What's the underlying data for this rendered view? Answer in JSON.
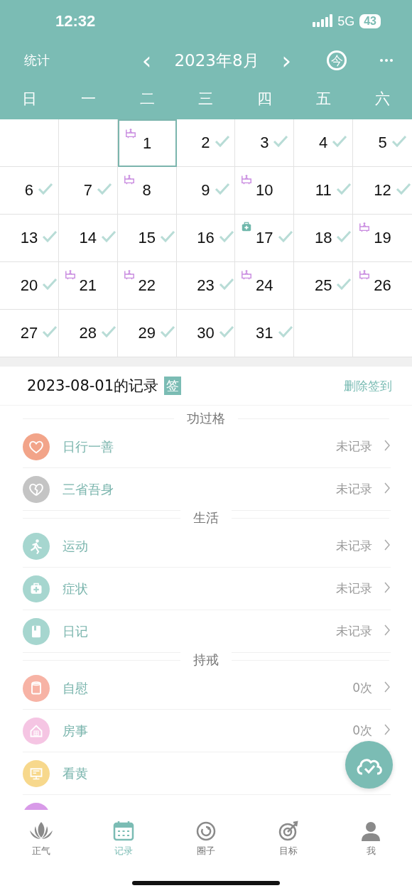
{
  "status_bar": {
    "time": "12:32",
    "network": "5G",
    "battery": "43"
  },
  "month_nav": {
    "stats": "统计",
    "prev": "‹",
    "title": "2023年8月",
    "next": "›",
    "today": "今"
  },
  "weekdays": [
    "日",
    "一",
    "二",
    "三",
    "四",
    "五",
    "六"
  ],
  "calendar": {
    "cells": [
      {
        "kind": "blank"
      },
      {
        "kind": "blank"
      },
      {
        "kind": "bath-day",
        "day": "1",
        "checked": false,
        "selected": true
      },
      {
        "kind": "day",
        "day": "2",
        "checked": true,
        "selected": false
      },
      {
        "kind": "day",
        "day": "3",
        "checked": true,
        "selected": false
      },
      {
        "kind": "day",
        "day": "4",
        "checked": true,
        "selected": false
      },
      {
        "kind": "day",
        "day": "5",
        "checked": true,
        "selected": false
      },
      {
        "kind": "day",
        "day": "6",
        "checked": true,
        "selected": false
      },
      {
        "kind": "day",
        "day": "7",
        "checked": true,
        "selected": false
      },
      {
        "kind": "bath-day",
        "day": "8",
        "checked": false,
        "selected": false
      },
      {
        "kind": "day",
        "day": "9",
        "checked": true,
        "selected": false
      },
      {
        "kind": "bath-day",
        "day": "10",
        "checked": false,
        "selected": false
      },
      {
        "kind": "day",
        "day": "11",
        "checked": true,
        "selected": false
      },
      {
        "kind": "day",
        "day": "12",
        "checked": true,
        "selected": false
      },
      {
        "kind": "day",
        "day": "13",
        "checked": true,
        "selected": false
      },
      {
        "kind": "day",
        "day": "14",
        "checked": true,
        "selected": false
      },
      {
        "kind": "day",
        "day": "15",
        "checked": true,
        "selected": false
      },
      {
        "kind": "day",
        "day": "16",
        "checked": true,
        "selected": false
      },
      {
        "kind": "medkit-day",
        "day": "17",
        "checked": true,
        "selected": false
      },
      {
        "kind": "day",
        "day": "18",
        "checked": true,
        "selected": false
      },
      {
        "kind": "bath-day",
        "day": "19",
        "checked": false,
        "selected": false
      },
      {
        "kind": "day",
        "day": "20",
        "checked": true,
        "selected": false
      },
      {
        "kind": "bath-day",
        "day": "21",
        "checked": false,
        "selected": false
      },
      {
        "kind": "bath-day",
        "day": "22",
        "checked": false,
        "selected": false
      },
      {
        "kind": "day",
        "day": "23",
        "checked": true,
        "selected": false
      },
      {
        "kind": "bath-day",
        "day": "24",
        "checked": false,
        "selected": false
      },
      {
        "kind": "day",
        "day": "25",
        "checked": true,
        "selected": false
      },
      {
        "kind": "bath-day",
        "day": "26",
        "checked": false,
        "selected": false
      },
      {
        "kind": "day",
        "day": "27",
        "checked": true,
        "selected": false
      },
      {
        "kind": "day",
        "day": "28",
        "checked": true,
        "selected": false
      },
      {
        "kind": "day",
        "day": "29",
        "checked": true,
        "selected": false
      },
      {
        "kind": "day",
        "day": "30",
        "checked": true,
        "selected": false
      },
      {
        "kind": "day",
        "day": "31",
        "checked": true,
        "selected": false
      },
      {
        "kind": "blank"
      },
      {
        "kind": "blank"
      }
    ]
  },
  "record": {
    "title": "2023-08-01的记录",
    "badge": "签",
    "action": "删除签到",
    "sections": [
      {
        "title": "功过格",
        "items": [
          {
            "kind": "heart",
            "color": "#f2a489",
            "label": "日行一善",
            "value": "未记录"
          },
          {
            "kind": "broken-heart",
            "color": "#c4c4c4",
            "label": "三省吾身",
            "value": "未记录"
          }
        ]
      },
      {
        "title": "生活",
        "items": [
          {
            "kind": "runner",
            "color": "#a6d6cf",
            "label": "运动",
            "value": "未记录"
          },
          {
            "kind": "medkit",
            "color": "#a6d6cf",
            "label": "症状",
            "value": "未记录"
          },
          {
            "kind": "book",
            "color": "#a6d6cf",
            "label": "日记",
            "value": "未记录"
          }
        ]
      },
      {
        "title": "持戒",
        "items": [
          {
            "kind": "tissue-roll",
            "color": "#f7b3a5",
            "label": "自慰",
            "value": "0次"
          },
          {
            "kind": "house",
            "color": "#f5c5e3",
            "label": "房事",
            "value": "0次"
          },
          {
            "kind": "monitor",
            "color": "#f7d88c",
            "label": "看黄"
          },
          {
            "kind": "partial",
            "color": "#d89ae8"
          }
        ]
      }
    ]
  },
  "tabs": [
    {
      "label": "正气",
      "kind": "lotus",
      "selected": false
    },
    {
      "label": "记录",
      "kind": "calendar",
      "selected": true
    },
    {
      "label": "圈子",
      "kind": "ring",
      "selected": false
    },
    {
      "label": "目标",
      "kind": "target",
      "selected": false
    },
    {
      "label": "我",
      "kind": "person",
      "selected": false
    }
  ]
}
